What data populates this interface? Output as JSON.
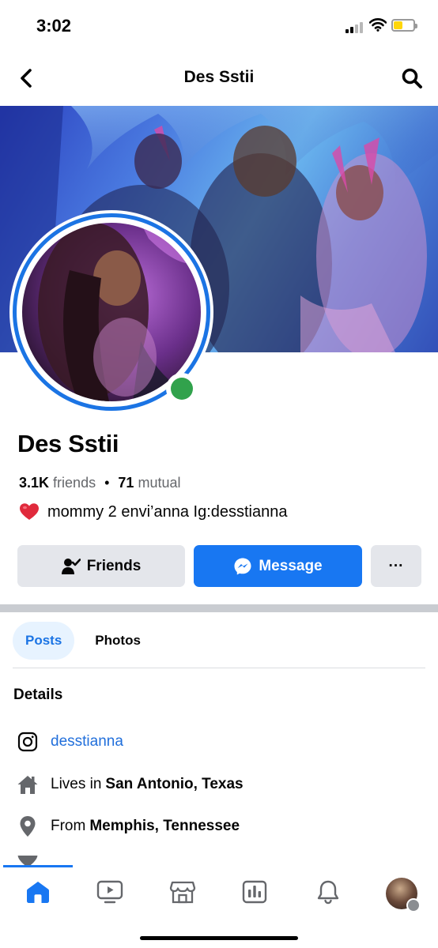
{
  "status_bar": {
    "time": "3:02"
  },
  "header": {
    "title": "Des Sstii",
    "back_icon": "chevron-left-icon",
    "search_icon": "search-icon"
  },
  "profile": {
    "name": "Des Sstii",
    "friends_count": "3.1K",
    "friends_label": "friends",
    "separator": "•",
    "mutual_count": "71",
    "mutual_label": "mutual",
    "bio": "mommy 2 envi’anna Ig:desstianna",
    "online": true
  },
  "actions": {
    "friends_label": "Friends",
    "message_label": "Message",
    "more_label": "···"
  },
  "tabs": [
    {
      "label": "Posts",
      "active": true
    },
    {
      "label": "Photos",
      "active": false
    }
  ],
  "details": {
    "title": "Details",
    "instagram": "desstianna",
    "lives_prefix": "Lives in",
    "lives_place": "San Antonio, Texas",
    "from_prefix": "From",
    "from_place": "Memphis, Tennessee"
  },
  "bottom_nav": {
    "items": [
      "home-icon",
      "video-icon",
      "marketplace-icon",
      "news-icon",
      "bell-icon",
      "profile-avatar"
    ]
  },
  "colors": {
    "accent": "#1877f2",
    "online": "#31a24c",
    "link": "#216fdb",
    "secondary_text": "#65676b",
    "button_grey": "#e4e6eb"
  }
}
